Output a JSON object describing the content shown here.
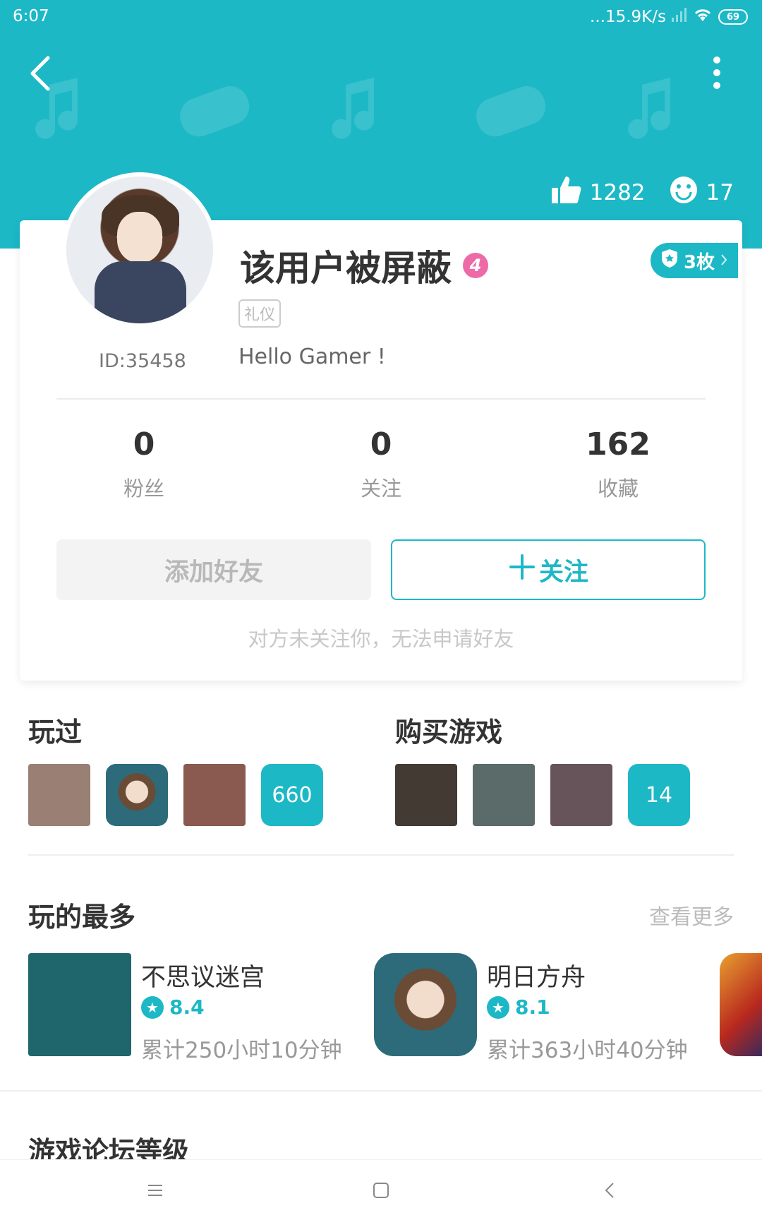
{
  "status_bar": {
    "time": "6:07",
    "network_speed": "...15.9K/s",
    "battery": "69"
  },
  "header": {
    "likes": "1282",
    "smiles": "17",
    "colors": {
      "accent": "#1cb8c6"
    }
  },
  "profile": {
    "username": "该用户被屏蔽",
    "level": "4",
    "medals": "3枚",
    "tag": "礼仪",
    "id": "ID:35458",
    "bio": "Hello Gamer !"
  },
  "counts": [
    {
      "num": "0",
      "label": "粉丝"
    },
    {
      "num": "0",
      "label": "关注"
    },
    {
      "num": "162",
      "label": "收藏"
    }
  ],
  "actions": {
    "add_friend": "添加好友",
    "follow": "关注",
    "hint": "对方未关注你，无法申请好友"
  },
  "played": {
    "title": "玩过",
    "count": "660",
    "thumb_colors": [
      "#9a7f74",
      "anime",
      "#8a5a50"
    ]
  },
  "purchased": {
    "title": "购买游戏",
    "count": "14",
    "thumb_colors": [
      "#433a34",
      "#5b6b69",
      "#67545a"
    ]
  },
  "most_played": {
    "title": "玩的最多",
    "more": "查看更多",
    "games": [
      {
        "name": "不思议迷宫",
        "rating": "8.4",
        "time": "累计250小时10分钟",
        "icon_color": "#1f666c"
      },
      {
        "name": "明日方舟",
        "rating": "8.1",
        "time": "累计363小时40分钟",
        "icon_color": "anime"
      }
    ]
  },
  "forum": {
    "title": "游戏论坛等级"
  }
}
